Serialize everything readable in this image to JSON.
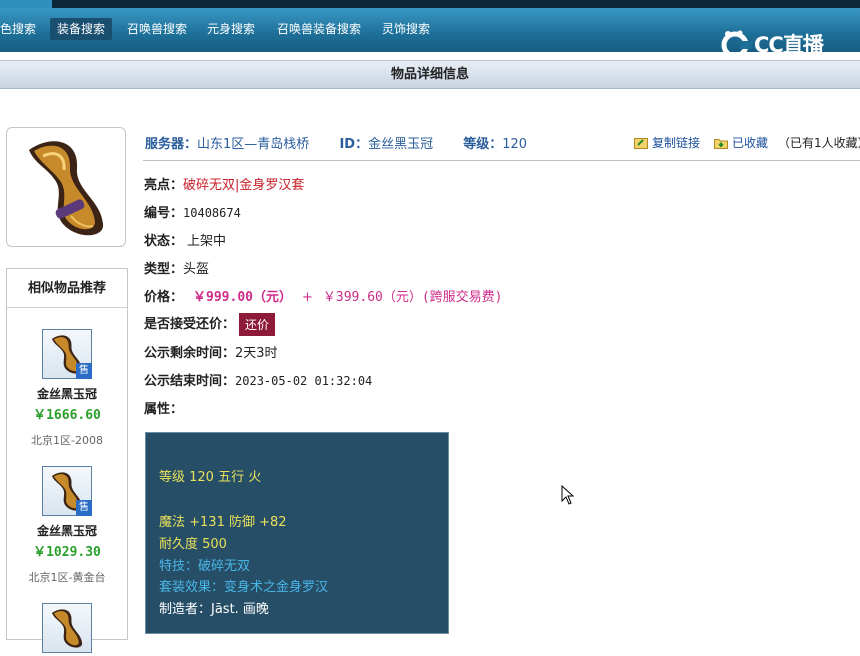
{
  "nav": {
    "items": [
      {
        "label": "色搜索",
        "active": false
      },
      {
        "label": "装备搜索",
        "active": true
      },
      {
        "label": "召唤兽搜索",
        "active": false
      },
      {
        "label": "元身搜索",
        "active": false
      },
      {
        "label": "召唤兽装备搜索",
        "active": false
      },
      {
        "label": "灵饰搜索",
        "active": false
      }
    ]
  },
  "logo": {
    "text": "CC直播"
  },
  "page_title": "物品详细信息",
  "summary": {
    "server_label": "服务器：",
    "server_value": "山东1区—青岛栈桥",
    "id_label": "ID：",
    "id_value": "金丝黑玉冠",
    "level_label": "等级：",
    "level_value": "120",
    "copy_link": "复制链接",
    "favorited": "已收藏",
    "favorite_count": "（已有1人收藏）"
  },
  "details": {
    "highlight_label": "亮点：",
    "highlight_value": "破碎无双|金身罗汉套",
    "number_label": "编号：",
    "number_value": "10408674",
    "status_label": "状态：",
    "status_value": "上架中",
    "type_label": "类型：",
    "type_value": "头盔",
    "price_label": "价格：",
    "price_value": "￥999.00（元）",
    "plus": "+",
    "fee_value": "￥399.60（元）(跨服交易费)",
    "counter_label": "是否接受还价：",
    "counter_button": "还价",
    "remaining_label": "公示剩余时间：",
    "remaining_value": "2天3时",
    "end_label": "公示结束时间：",
    "end_value": "2023-05-02 01:32:04",
    "attr_label": "属性："
  },
  "attributes": {
    "line1": "等级 120  五行 火",
    "line2": "魔法 +131 防御 +82",
    "line3": "耐久度 500",
    "line4": "特技：破碎无双",
    "line5": "套装效果：变身术之金身罗汉",
    "line6": "制造者：Jāst. 画晚"
  },
  "similar": {
    "header": "相似物品推荐",
    "sale_badge": "售",
    "items": [
      {
        "name": "金丝黑玉冠",
        "price": "￥1666.60",
        "server": "北京1区-2008"
      },
      {
        "name": "金丝黑玉冠",
        "price": "￥1029.30",
        "server": "北京1区-黄金台"
      }
    ]
  },
  "colors": {
    "nav_bg": "#1d6f98",
    "label_blue": "#2a5d9c",
    "highlight_red": "#c8202a",
    "price_pink": "#cf2b8a",
    "attr_bg": "#264f67"
  }
}
